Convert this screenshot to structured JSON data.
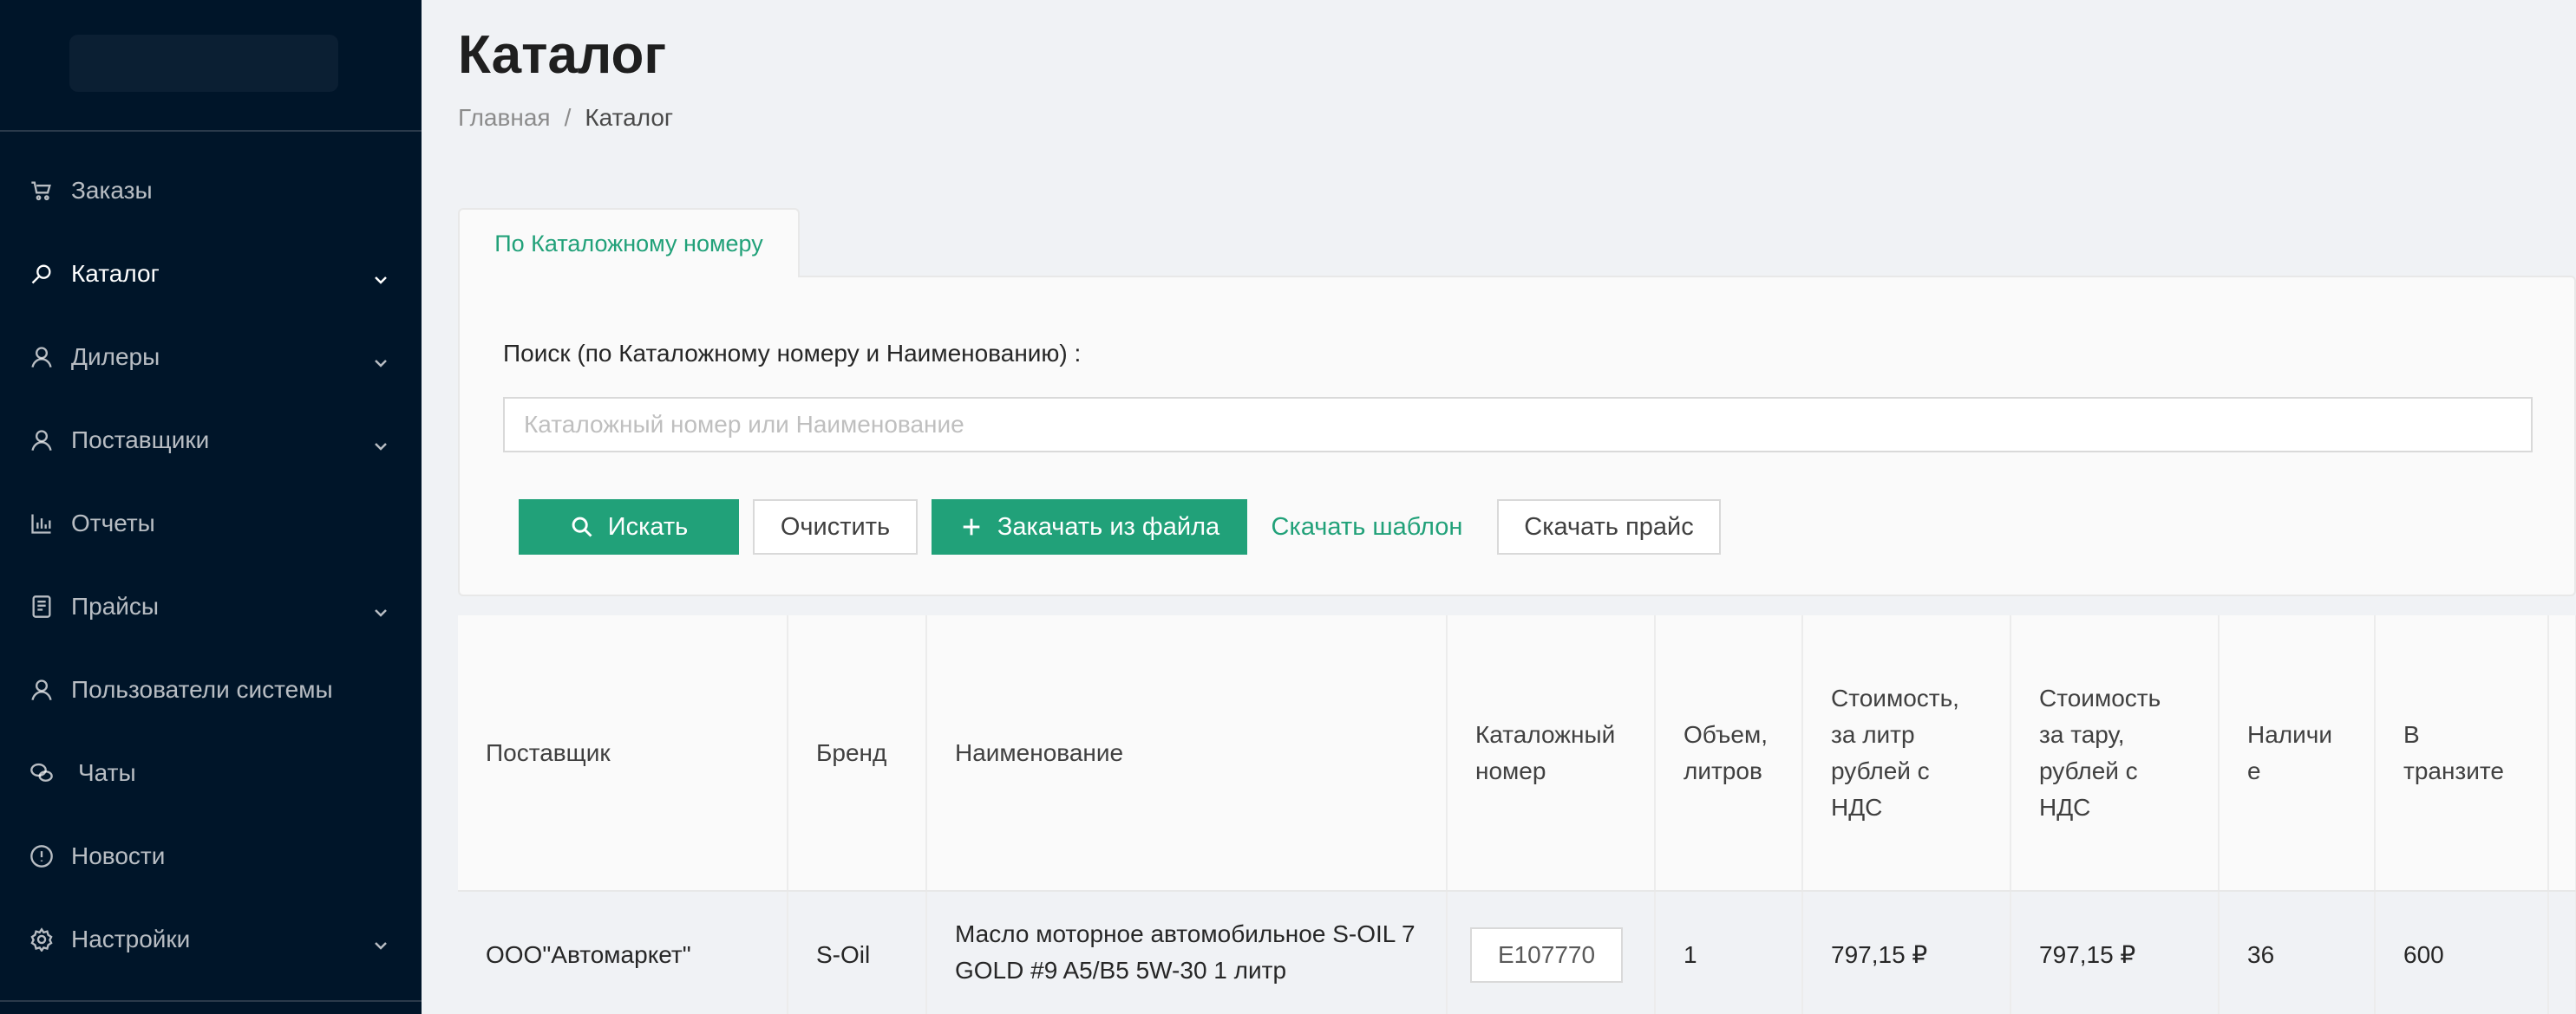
{
  "sidebar": {
    "items": [
      {
        "label": "Заказы",
        "icon": "cart-icon",
        "has_chevron": false,
        "active": false
      },
      {
        "label": "Каталог",
        "icon": "search-icon",
        "has_chevron": true,
        "active": true
      },
      {
        "label": "Дилеры",
        "icon": "user-icon",
        "has_chevron": true,
        "active": false
      },
      {
        "label": "Поставщики",
        "icon": "user-icon",
        "has_chevron": true,
        "active": false
      },
      {
        "label": "Отчеты",
        "icon": "bar-chart-icon",
        "has_chevron": false,
        "active": false
      },
      {
        "label": "Прайсы",
        "icon": "document-icon",
        "has_chevron": true,
        "active": false
      },
      {
        "label": "Пользователи системы",
        "icon": "user-icon",
        "has_chevron": false,
        "active": false
      },
      {
        "label": "Чаты",
        "icon": "chat-icon",
        "has_chevron": false,
        "active": false
      },
      {
        "label": "Новости",
        "icon": "info-icon",
        "has_chevron": false,
        "active": false
      },
      {
        "label": "Настройки",
        "icon": "gear-icon",
        "has_chevron": true,
        "active": false
      }
    ]
  },
  "header": {
    "title": "Каталог",
    "breadcrumb": {
      "home": "Главная",
      "separator": "/",
      "current": "Каталог"
    }
  },
  "tabs": [
    {
      "label": "По Каталожному номеру"
    }
  ],
  "search": {
    "label": "Поиск (по Каталожному номеру и Наименованию) :",
    "placeholder": "Каталожный номер или Наименование",
    "value": ""
  },
  "buttons": {
    "search": "Искать",
    "clear": "Очистить",
    "upload": "Закачать из файла",
    "download_template": "Скачать шаблон",
    "download_price": "Скачать прайс"
  },
  "table": {
    "columns": [
      "Поставщик",
      "Бренд",
      "Наименование",
      "Каталожный номер",
      "Объем, литров",
      "Стоимость, за литр рублей с НДС",
      "Стоимость за тару, рублей с НДС",
      "Наличие",
      "В транзите"
    ],
    "rows": [
      {
        "supplier": "ООО\"Автомаркет\"",
        "brand": "S-Oil",
        "name": "Масло моторное автомобильное S-OIL 7 GOLD #9 A5/B5 5W-30 1 литр",
        "catalog_number": "E107770",
        "volume": "1",
        "price_per_liter": "797,15 ₽",
        "price_per_container": "797,15 ₽",
        "stock": "36",
        "in_transit": "600"
      }
    ]
  },
  "colors": {
    "accent": "#21a179",
    "sidebar_bg": "#001529",
    "page_bg": "#f0f2f5"
  }
}
